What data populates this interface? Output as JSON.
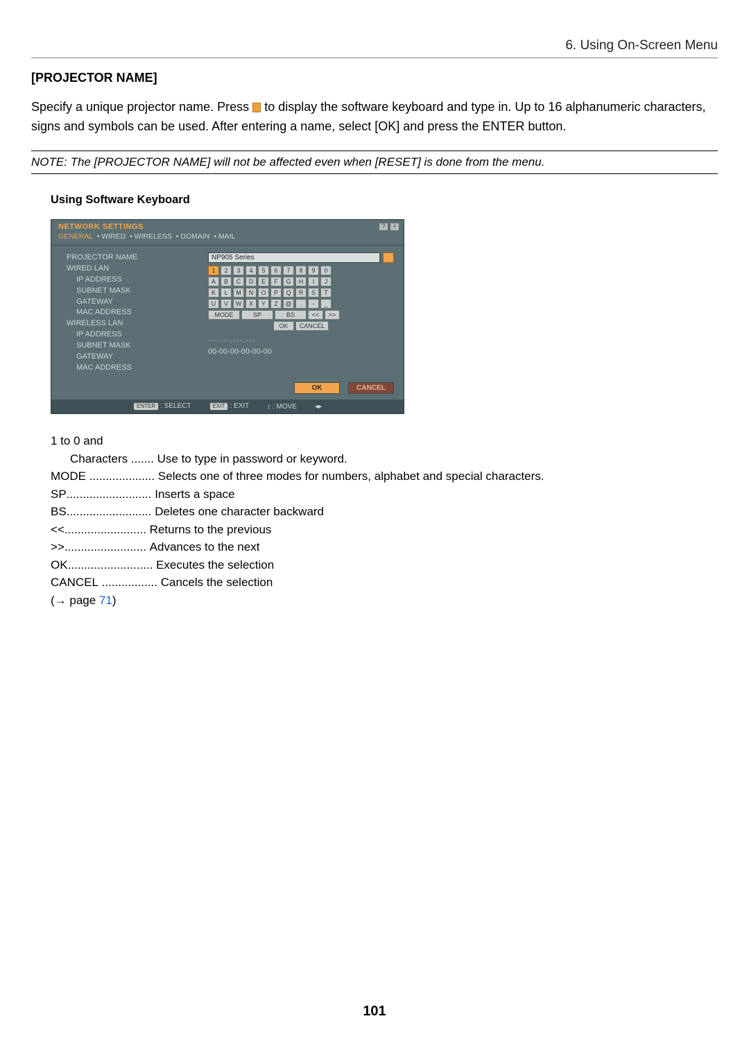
{
  "header": {
    "chapter": "6. Using On-Screen Menu"
  },
  "section": {
    "title": "[PROJECTOR NAME]",
    "para_a": "Specify a unique projector name. Press ",
    "para_b": " to display the software keyboard and type in. Up to 16 alphanumeric characters, signs and symbols can be used. After entering a name, select [OK] and press the ENTER button."
  },
  "note": "NOTE: The [PROJECTOR NAME] will not be affected even when [RESET] is done from the menu.",
  "subsection_title": "Using Software Keyboard",
  "osd": {
    "window_title": "NETWORK SETTINGS",
    "tabs": [
      "GENERAL",
      "WIRED",
      "WIRELESS",
      "DOMAIN",
      "MAIL"
    ],
    "left_labels": {
      "projector_name": "PROJECTOR NAME",
      "wired_lan": "WIRED LAN",
      "ip_address": "IP ADDRESS",
      "subnet_mask": "SUBNET MASK",
      "gateway": "GATEWAY",
      "mac_address": "MAC ADDRESS",
      "wireless_lan": "WIRELESS LAN"
    },
    "projector_name_value": "NP905 Series",
    "keys_row1": [
      "1",
      "2",
      "3",
      "4",
      "5",
      "6",
      "7",
      "8",
      "9",
      "0"
    ],
    "keys_row2": [
      "A",
      "B",
      "C",
      "D",
      "E",
      "F",
      "G",
      "H",
      "I",
      "J"
    ],
    "keys_row3": [
      "K",
      "L",
      "M",
      "N",
      "O",
      "P",
      "Q",
      "R",
      "S",
      "T"
    ],
    "keys_row4": [
      "U",
      "V",
      "W",
      "X",
      "Y",
      "Z",
      "@",
      ".",
      "-",
      "_"
    ],
    "keys_row5": {
      "mode": "MODE",
      "sp": "SP",
      "bs": "BS",
      "prev": "<<",
      "next": ">>"
    },
    "keys_row6": {
      "ok": "OK",
      "cancel": "CANCEL"
    },
    "blank_ip": "---.---.---.---",
    "mac_value": "00-00-00-00-00-00",
    "footer": {
      "ok": "OK",
      "cancel": "CANCEL"
    },
    "status": {
      "enter": "ENTER",
      "select": ": SELECT",
      "exit": "EXIT",
      "exit_lbl": ": EXIT",
      "move": ": MOVE",
      "arrows": ""
    }
  },
  "defs": {
    "chars_term": "1 to 0 and",
    "chars_term2": "Characters",
    "chars_desc": "Use to type in password or keyword.",
    "mode_term": "MODE",
    "mode_desc": "Selects one of three modes for numbers, alphabet and special characters.",
    "sp_term": "SP",
    "sp_desc": "Inserts a space",
    "bs_term": "BS",
    "bs_desc": "Deletes one character backward",
    "prev_term": "<< ",
    "prev_desc": "Returns to the previous",
    "next_term": ">> ",
    "next_desc": "Advances to the next",
    "ok_term": "OK",
    "ok_desc": "Executes the selection",
    "cancel_term": "CANCEL",
    "cancel_desc": "Cancels the selection"
  },
  "pageref": {
    "prefix": "(→ page ",
    "num": "71",
    "suffix": ")"
  },
  "page_number": "101"
}
